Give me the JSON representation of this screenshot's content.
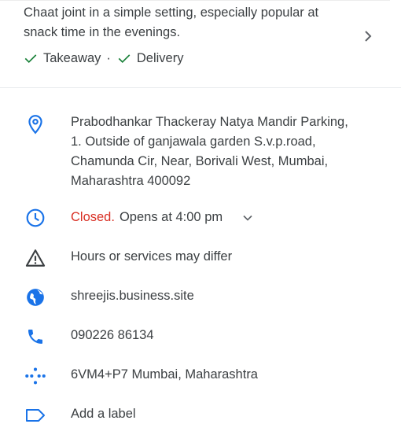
{
  "description": {
    "text": "Chaat joint in a simple setting, especially popular at snack time in the evenings."
  },
  "services": {
    "takeaway": "Takeaway",
    "separator": "·",
    "delivery": "Delivery"
  },
  "address": {
    "lines": [
      "Prabodhankar Thackeray Natya Mandir Parking,",
      "1. Outside of ganjawala garden S.v.p.road,",
      "Chamunda Cir, Near, Borivali West, Mumbai,",
      "Maharashtra 400092"
    ]
  },
  "hours": {
    "status": "Closed.",
    "opens": "Opens at 4:00 pm"
  },
  "notice": {
    "text": "Hours or services may differ"
  },
  "website": {
    "text": "shreejis.business.site"
  },
  "phone": {
    "text": "090226 86134"
  },
  "plus_code": {
    "text": "6VM4+P7 Mumbai, Maharashtra"
  },
  "label": {
    "text": "Add a label"
  },
  "colors": {
    "accent": "#1a73e8",
    "check": "#188038",
    "closed": "#d93025",
    "text": "#3c4043",
    "icon_gray": "#5f6368"
  },
  "icons": {
    "services_check": "check-icon",
    "more": "chevron-right-icon",
    "address": "location-pin-icon",
    "hours": "clock-icon",
    "hours_expand": "chevron-down-icon",
    "notice": "warning-icon",
    "website": "globe-icon",
    "phone": "phone-icon",
    "plus_code": "plus-code-icon",
    "label": "label-icon"
  }
}
